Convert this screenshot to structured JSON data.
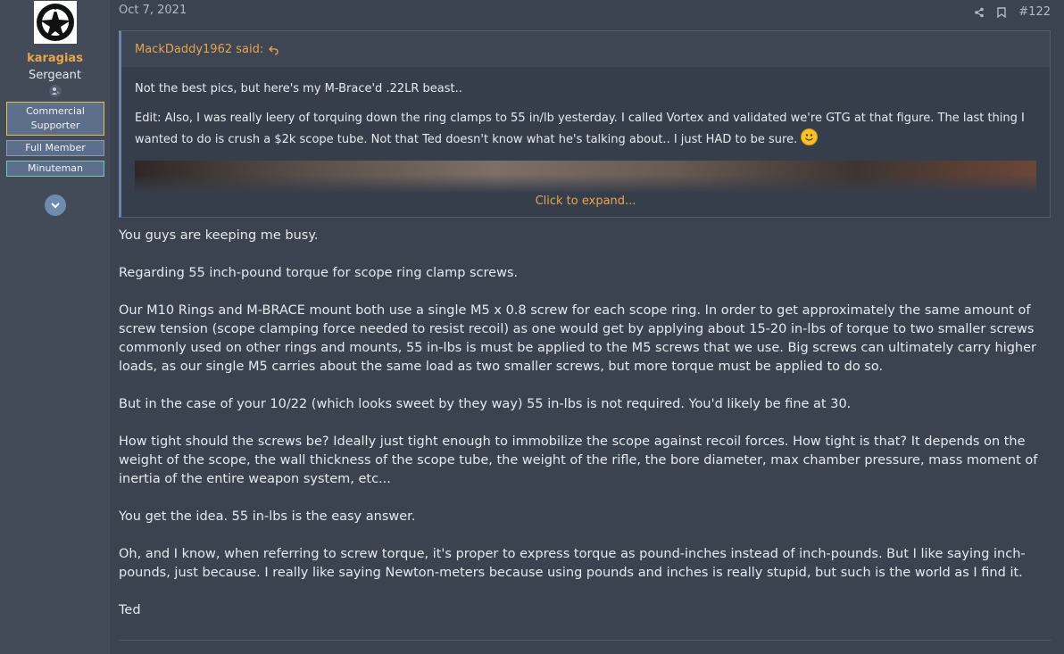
{
  "user": {
    "name": "karagias",
    "title": "Sergeant",
    "banners": [
      "Commercial Supporter",
      "Full Member",
      "Minuteman"
    ]
  },
  "post": {
    "date": "Oct 7, 2021",
    "number": "#122",
    "quote": {
      "author": "MackDaddy1962 said:",
      "paragraphs": [
        "Not the best pics, but here's my M-Brace'd .22LR beast..",
        "Edit: Also, I was really leery of torquing down the ring clamps to 55 in/lb yesterday. I called Vortex and validated we're GTG at that figure. The last thing I wanted to do is crush a $2k scope tube. Not that Ted doesn't know what he's talking about.. I just HAD to be sure."
      ],
      "expand": "Click to expand..."
    },
    "body": [
      "You guys are keeping me busy.",
      "Regarding 55 inch-pound torque for scope ring clamp screws.",
      "Our M10 Rings and M-BRACE mount both use a single M5 x 0.8 screw for each scope ring. In order to get approximately the same amount of screw tension (scope clamping force needed to resist recoil) as one would get by applying about 15-20 in-lbs of torque to two smaller screws commonly used on other rings and mounts, 55 in-lbs is must be applied to the M5 screws that we use. Big screws can ultimately carry higher loads, as our single M5 carries about the same load as two smaller screws, but more torque must be applied to do so.",
      "But in the case of your 10/22 (which looks sweet by they way) 55 in-lbs is not required. You'd likely be fine at 30.",
      "How tight should the screws be? Ideally just tight enough to immobilize the scope against recoil forces. How tight is that? It depends on the weight of the scope, the wall thickness of the scope tube, the weight of the rifle, the bore diameter, max chamber pressure, mass moment of inertia of the entire weapon system, etc...",
      "You get the idea. 55 in-lbs is the easy answer.",
      "Oh, and I know, when referring to screw torque, it's proper to express torque as pound-inches instead of inch-pounds. But I like saying inch-pounds, just because. I really like saying Newton-meters because using pounds and inches is really stupid, but such is the world as I find it.",
      "Ted"
    ]
  },
  "colors": {
    "accent": "#e8a54a",
    "background": "#3b4250",
    "sidebar": "#434b59",
    "quote_border": "#6d86ad"
  },
  "icons": [
    "avatar-logo-icon",
    "moderator-icon",
    "chevron-down-icon",
    "share-icon",
    "bookmark-icon",
    "reply-arrow-icon",
    "smiley-icon"
  ]
}
